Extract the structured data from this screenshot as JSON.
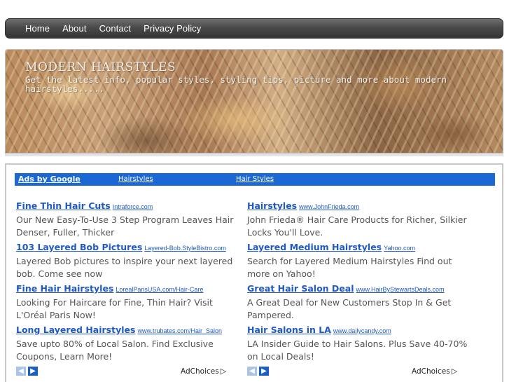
{
  "nav": {
    "items": [
      "Home",
      "About",
      "Contact",
      "Privacy Policy"
    ]
  },
  "banner": {
    "title": "MODERN HAIRSTYLES",
    "tagline": "Get the latest info, popular styles, styling tips, picture and more about modern hairstyles....."
  },
  "adsbar": {
    "ads_by": "Ads by Google",
    "link1": "Hairstyles",
    "link2": "Hair Styles"
  },
  "ads_left": [
    {
      "title": "Fine Thin Hair Cuts",
      "url": "Intraforce.com",
      "desc": "Our New Easy-To-Use 3 Step Program Leaves Hair Denser, Fuller, Thicker"
    },
    {
      "title": "103 Layered Bob Pictures",
      "url": "Layered-Bob.StyleBistro.com",
      "desc": "Layered Bob pictures to inspire your next layered bob. Come see now"
    },
    {
      "title": "Fine Hair Hairstyles",
      "url": "LorealParisUSA.com/Hair-Care",
      "desc": "Looking For Haircare for Fine, Thin Hair? Visit L'Oréal Paris Now!"
    },
    {
      "title": "Long Layered Hairstyles",
      "url": "www.trubates.com/Hair_Salon",
      "desc": "Save upto 80% of Local Salon. Find Exclusive Coupons, Learn More!"
    }
  ],
  "ads_right": [
    {
      "title": "Hairstyles",
      "url": "www.JohnFrieda.com",
      "desc": "John Frieda® Hair Care Products for Richer, Silkier Locks You'll Love."
    },
    {
      "title": "Layered Medium Hairstyles",
      "url": "Yahoo.com",
      "desc": "Search for Layered Medium Hairstyles Find out more on Yahoo!"
    },
    {
      "title": "Great Hair Salon Deal",
      "url": "www.HairByStewartsDeals.com",
      "desc": "A Great Deal for New Customers Stop In & Get Pampered."
    },
    {
      "title": "Hair Salons in LA",
      "url": "www.dailycandy.com",
      "desc": "LA Insider Guide to Hair Salons. Plus Save 40-70% on Local Deals!"
    }
  ],
  "adchoices_label": "AdChoices",
  "icons": {
    "prev": "chevron-left-icon",
    "next": "chevron-right-icon",
    "adchoices": "adchoices-triangle-icon"
  }
}
